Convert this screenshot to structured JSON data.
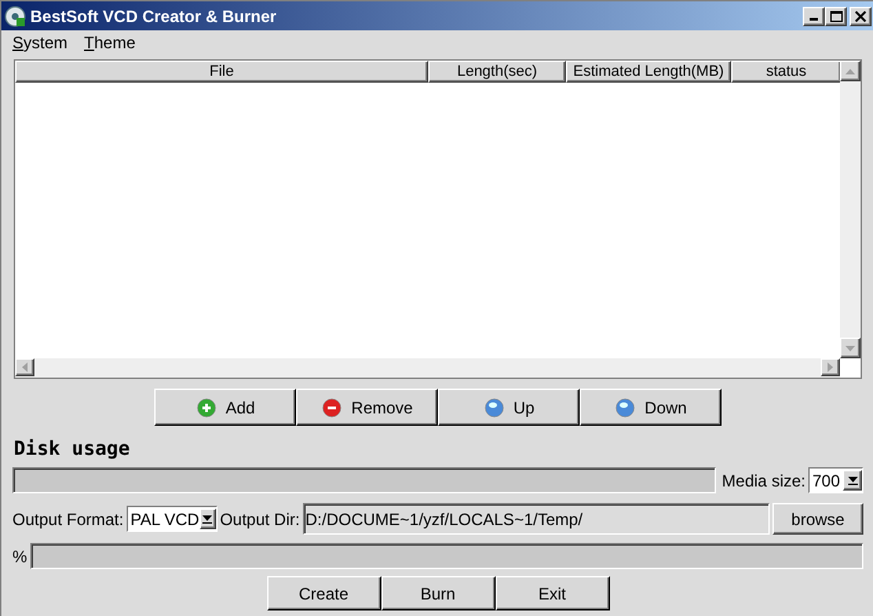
{
  "window": {
    "title": "BestSoft VCD Creator & Burner"
  },
  "menu": [
    "System",
    "Theme"
  ],
  "table": {
    "columns": [
      "File",
      "Length(sec)",
      "Estimated Length(MB)",
      "status"
    ]
  },
  "list_buttons": [
    {
      "label": "Add",
      "kind": "add"
    },
    {
      "label": "Remove",
      "kind": "remove"
    },
    {
      "label": "Up",
      "kind": "up"
    },
    {
      "label": "Down",
      "kind": "down"
    }
  ],
  "disk_usage": {
    "heading": "Disk usage",
    "media_size_label": "Media size:",
    "media_size": "700"
  },
  "output": {
    "format_label": "Output Format:",
    "format": "PAL VCD",
    "dir_label": "Output Dir:",
    "dir": "D:/DOCUME~1/yzf/LOCALS~1/Temp/",
    "browse": "browse"
  },
  "progress": {
    "label": "%"
  },
  "actions": [
    "Create",
    "Burn",
    "Exit"
  ]
}
